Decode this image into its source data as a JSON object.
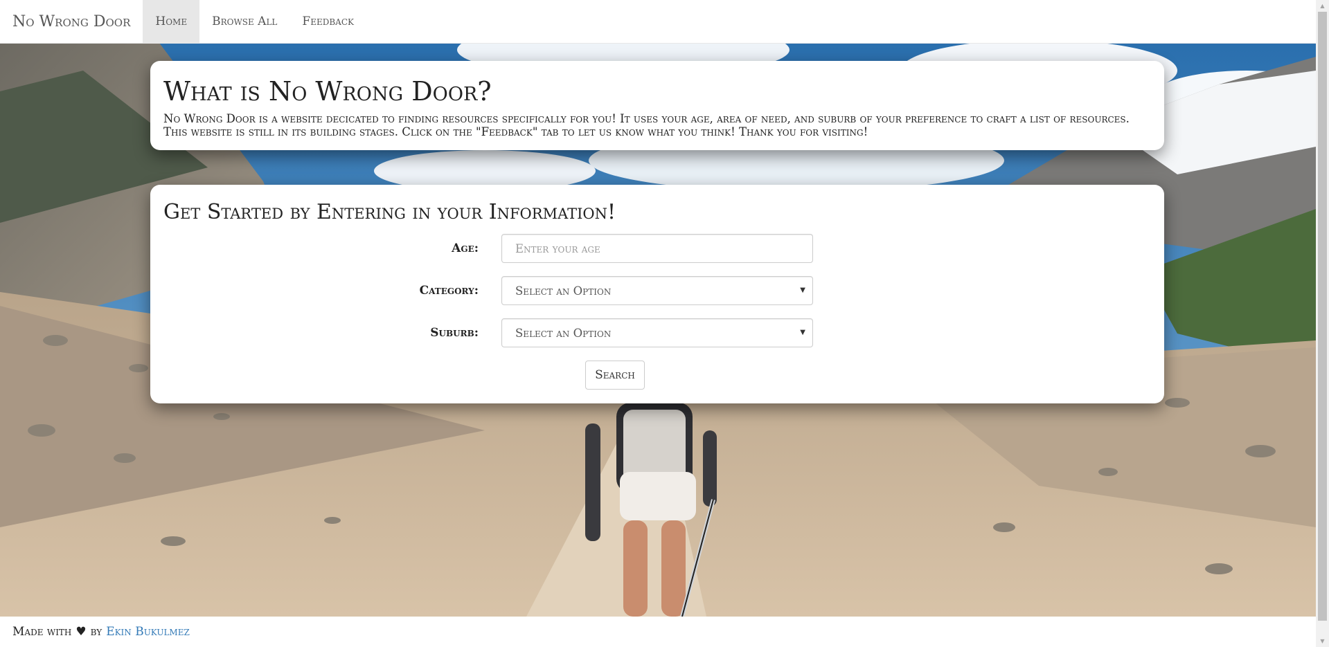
{
  "navbar": {
    "brand": "No Wrong Door",
    "items": [
      {
        "label": "Home",
        "active": true
      },
      {
        "label": "Browse All",
        "active": false
      },
      {
        "label": "Feedback",
        "active": false
      }
    ]
  },
  "about": {
    "title": "What is No Wrong Door?",
    "text": "No Wrong Door is a website decicated to finding resources specifically for you! It uses your age, area of need, and suburb of your preference to craft a list of resources. This website is still in its building stages. Click on the \"Feedback\" tab to let us know what you think! Thank you for visiting!"
  },
  "form": {
    "title": "Get Started by Entering in your Information!",
    "age": {
      "label": "Age:",
      "placeholder": "Enter your age",
      "value": ""
    },
    "category": {
      "label": "Category:",
      "selected": "Select an Option"
    },
    "suburb": {
      "label": "Suburb:",
      "selected": "Select an Option"
    },
    "search_label": "Search"
  },
  "footer": {
    "prefix": "Made with",
    "heart": "♥",
    "by": "by",
    "author": "Ekin Bukulmez"
  },
  "colors": {
    "link": "#337ab7",
    "nav_active_bg": "#e7e7e7",
    "text": "#222222"
  },
  "icons": {
    "heart": "heart-icon",
    "caret": "chevron-down-icon"
  }
}
